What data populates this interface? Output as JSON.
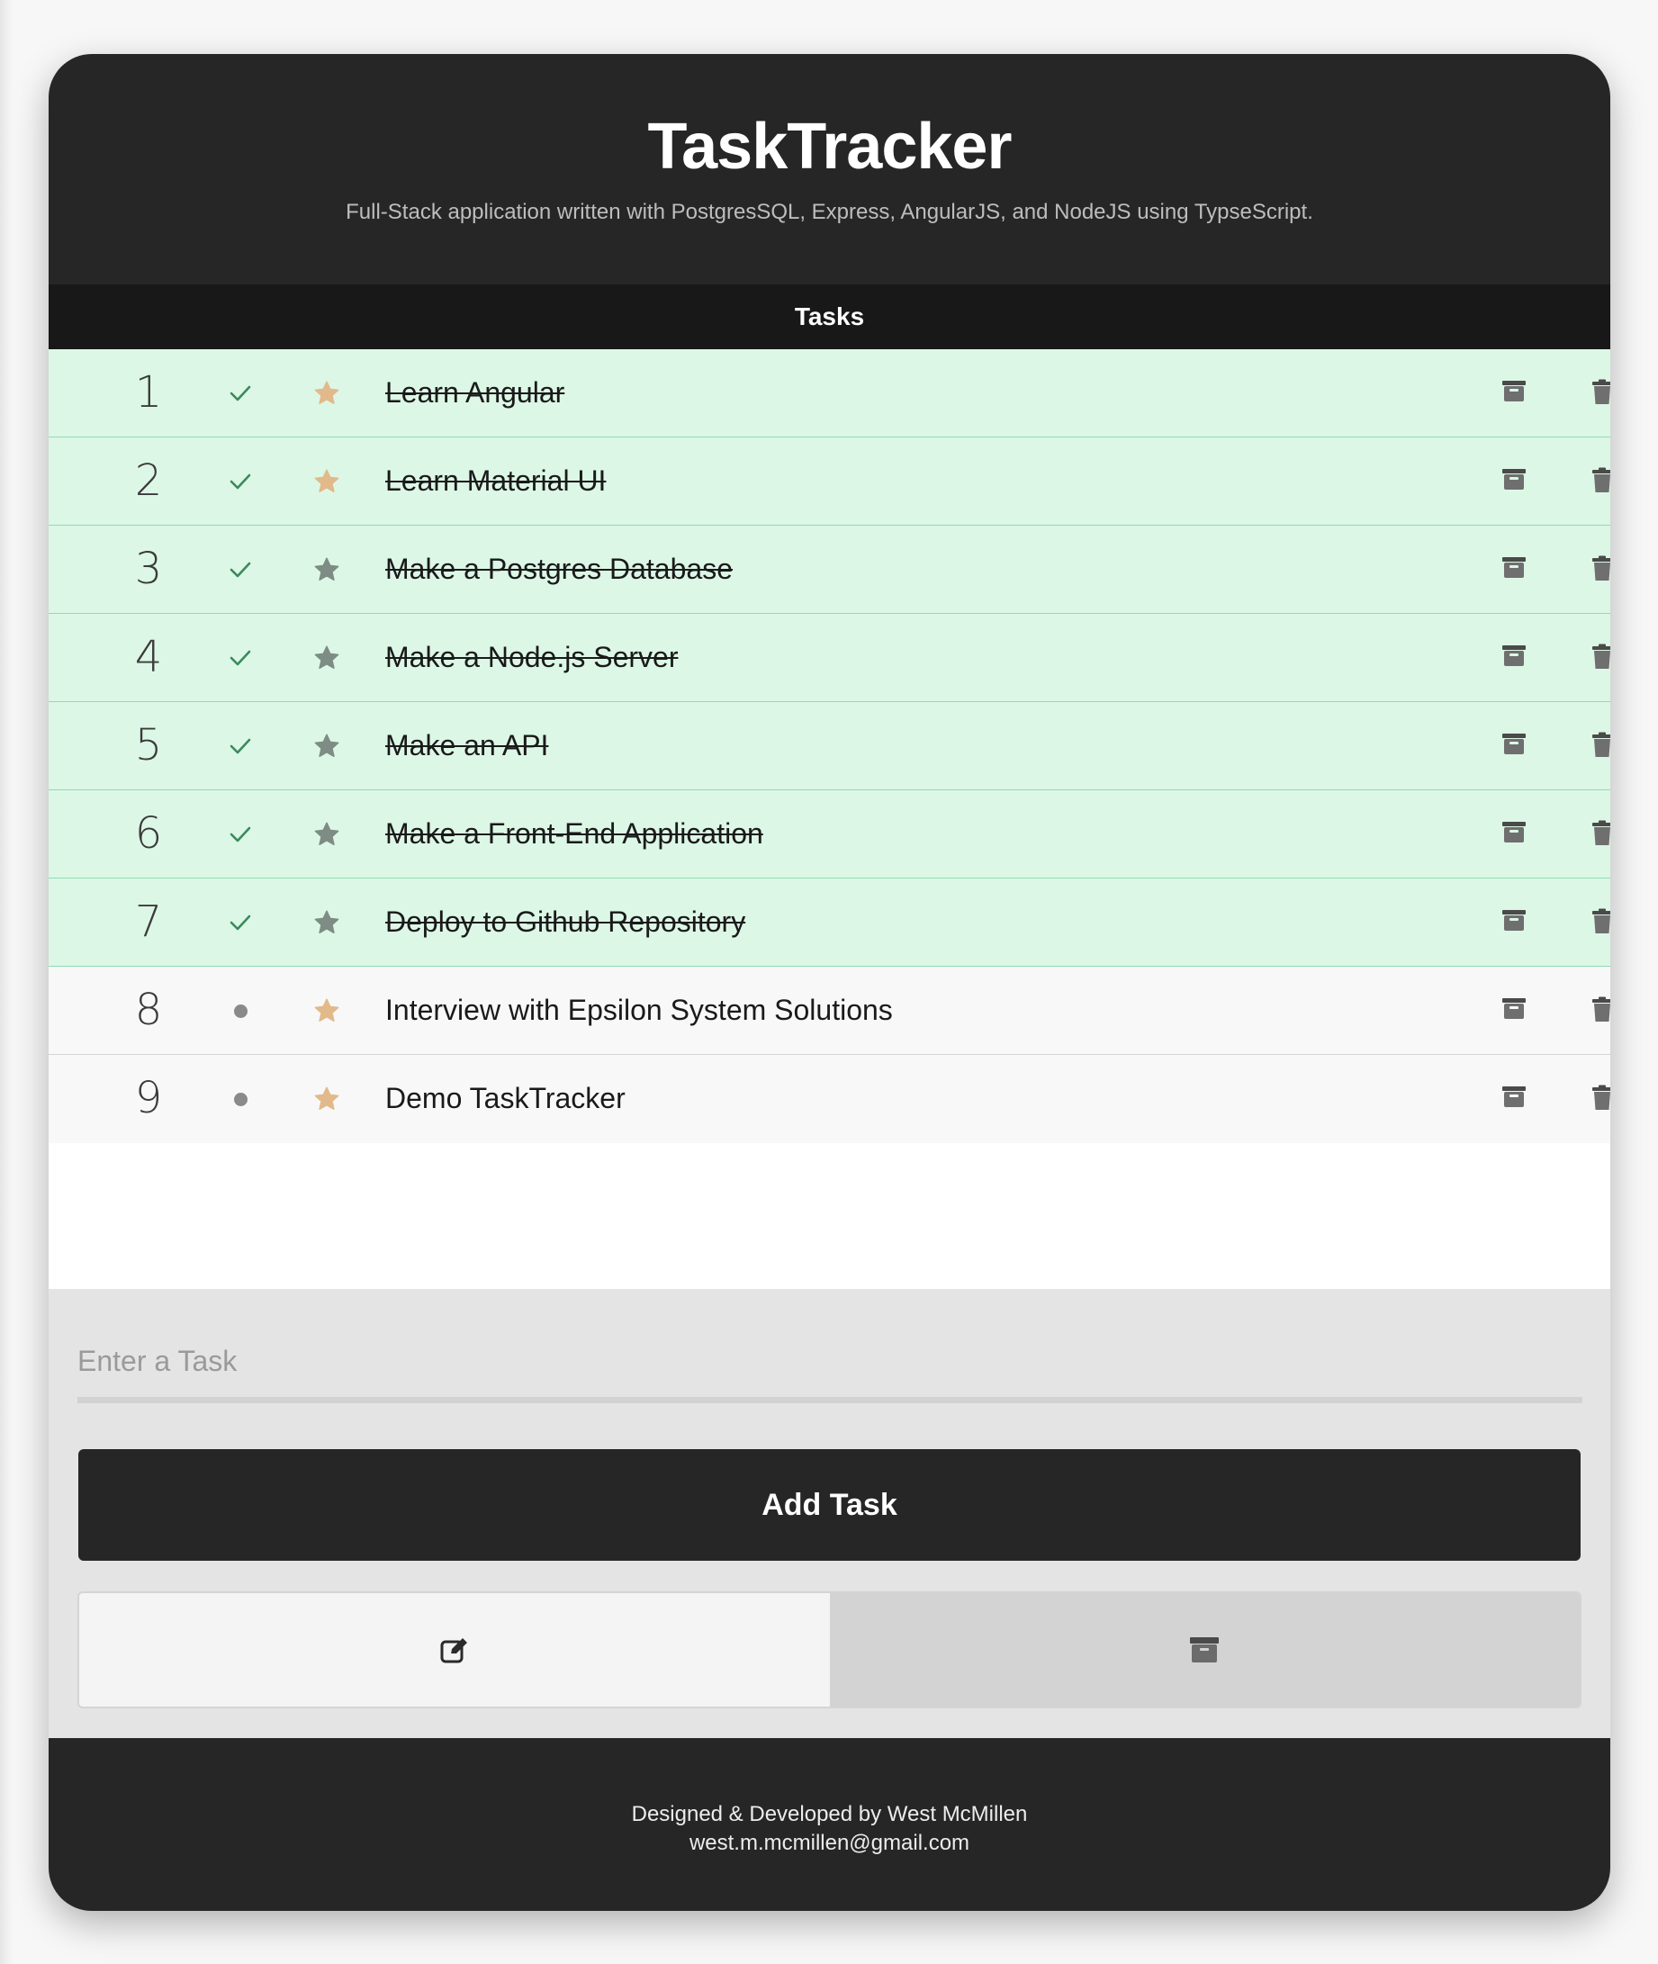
{
  "header": {
    "title": "TaskTracker",
    "subtitle": "Full-Stack application written with PostgresSQL, Express, AngularJS, and NodeJS using TypseScript."
  },
  "list": {
    "heading": "Tasks",
    "tasks": [
      {
        "number": "1",
        "text": "Learn Angular",
        "completed": true,
        "starred": true,
        "status_icon": "check-icon"
      },
      {
        "number": "2",
        "text": "Learn Material UI",
        "completed": true,
        "starred": true,
        "status_icon": "check-icon"
      },
      {
        "number": "3",
        "text": "Make a Postgres Database",
        "completed": true,
        "starred": false,
        "status_icon": "check-icon"
      },
      {
        "number": "4",
        "text": "Make a Node.js Server",
        "completed": true,
        "starred": false,
        "status_icon": "check-icon"
      },
      {
        "number": "5",
        "text": "Make an API",
        "completed": true,
        "starred": false,
        "status_icon": "check-icon"
      },
      {
        "number": "6",
        "text": "Make a Front-End Application",
        "completed": true,
        "starred": false,
        "status_icon": "check-icon"
      },
      {
        "number": "7",
        "text": "Deploy to Github Repository",
        "completed": true,
        "starred": false,
        "status_icon": "check-icon"
      },
      {
        "number": "8",
        "text": "Interview with Epsilon System Solutions",
        "completed": false,
        "starred": true,
        "status_icon": "dot-icon"
      },
      {
        "number": "9",
        "text": "Demo TaskTracker",
        "completed": false,
        "starred": true,
        "status_icon": "dot-icon"
      }
    ]
  },
  "form": {
    "input_placeholder": "Enter a Task",
    "input_value": "",
    "add_button_label": "Add Task",
    "toggle_left_icon": "edit-icon",
    "toggle_right_icon": "archive-icon"
  },
  "footer": {
    "credit": "Designed & Developed by West McMillen",
    "email": "west.m.mcmillen@gmail.com"
  },
  "colors": {
    "dark": "#262626",
    "completed_row": "#dcf7e6",
    "check": "#3a8a5c",
    "star_active": "#e2b98a",
    "star_inactive": "#7d8c84"
  }
}
